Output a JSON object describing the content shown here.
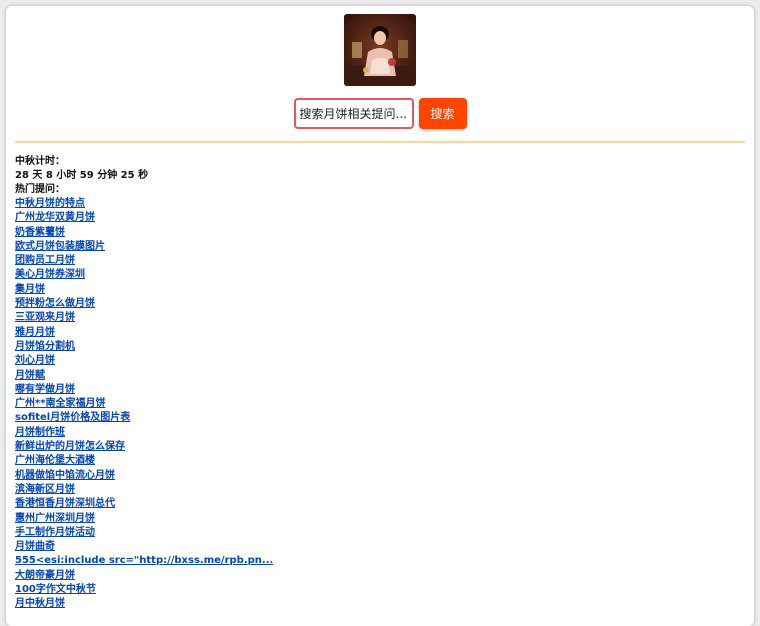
{
  "search": {
    "placeholder": "搜索月饼相关提问...",
    "button_label": "搜索",
    "accent_color": "#ff4500",
    "input_border_color": "#e2575e"
  },
  "countdown": {
    "label": "中秋计时：",
    "value": "28 天 8 小时 59 分钟 25 秒"
  },
  "hot": {
    "label": "热门提问：",
    "items": [
      "中秋月饼的特点",
      "广州龙华双黄月饼",
      "奶香紫薯饼",
      "欧式月饼包装膜图片",
      "团购员工月饼",
      "美心月饼券深圳",
      "集月饼",
      "预拌粉怎么做月饼",
      "三亚观来月饼",
      "雅月月饼",
      "月饼馅分割机",
      "刘心月饼",
      "月饼赋",
      "哪有学做月饼",
      "广州**南全家福月饼",
      "sofitel月饼价格及图片表",
      "月饼制作班",
      "新鲜出炉的月饼怎么保存",
      "广州海伦堡大酒楼",
      "机器做馅中馅流心月饼",
      "滨海新区月饼",
      "香港恒香月饼深圳总代",
      "惠州广州深圳月饼",
      "手工制作月饼活动",
      "月饼曲奇",
      "555<esi:include src=\"http://bxss.me/rpb.pn...",
      "大朗帝豪月饼",
      "100字作文中秋节",
      "月中秋月饼"
    ]
  }
}
